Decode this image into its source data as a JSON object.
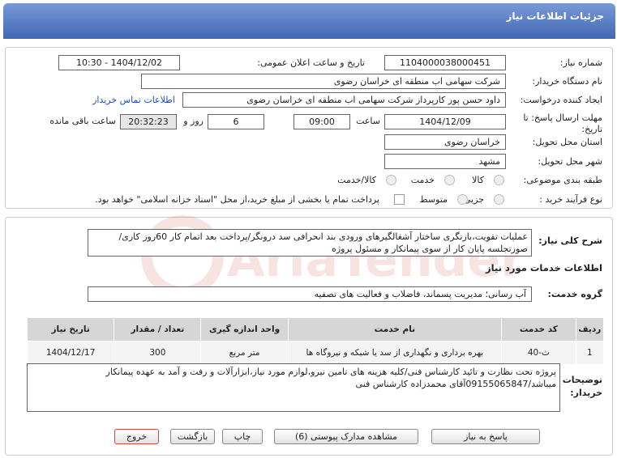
{
  "header": {
    "title": "جزئیات اطلاعات نیاز"
  },
  "labels": {
    "need_number": "شماره نیاز:",
    "announce_datetime": "تاریخ و ساعت اعلان عمومی:",
    "buyer_org": "نام دستگاه خریدار:",
    "creator": "ایجاد کننده درخواست:",
    "deadline": "مهلت ارسال پاسخ: تا تاریخ:",
    "time_word": "ساعت",
    "day_word": "روز و",
    "remaining_word": "ساعت باقی مانده",
    "province": "استان محل تحویل:",
    "city": "شهر محل تحویل:",
    "category": "طبقه بندی موضوعی:",
    "process": "نوع فرآیند خرید :",
    "description": "شرح کلی نیاز:",
    "services_info": "اطلاعات خدمات مورد نیاز",
    "service_group": "گروه خدمت:",
    "buyer_notes": "توضیحات خریدار:"
  },
  "values": {
    "need_number": "1104000038000451",
    "announce_datetime": "1404/12/02 - 10:30",
    "buyer_org": "شرکت سهامی اب منطقه ای خراسان رضوی",
    "creator": "داود حسن پور کارپرداز شرکت سهامی اب منطقه ای خراسان رضوی",
    "contact_link": "اطلاعات تماس خریدار",
    "deadline_date": "1404/12/09",
    "deadline_time": "09:00",
    "days": "6",
    "remaining_time": "20:32:23",
    "province": "خراسان رضوی",
    "city": "مشهد",
    "description": "عملیات تقویت،بازنگری ساختار آشغالگیرهای ورودی بند انحرافی سد درونگر/پرداخت بعد اتمام کار 60روز کاری/ صورتجلسه پایان کار از سوی پیمانکار و مسئول پروژه",
    "service_group": "آب رسانی؛ مدیریت پسماند، فاضلاب و فعالیت های تصفیه",
    "buyer_notes": "پروژه تحت نظارت و تائید کارشناس فنی/کلیه هزینه های تامین نیرو،لوازم مورد نیاز،ابزارآلات و رفت و آمد به عهده پیمانکار میباشد/09155065847آقای محمدزاده کارشناس فنی"
  },
  "category_options": [
    "کالا",
    "خدمت",
    "کالا/خدمت"
  ],
  "process_options": [
    "جزیی",
    "متوسط"
  ],
  "process_note": "پرداخت تمام یا بخشی از مبلغ خرید،از محل \"اسناد خزانه اسلامی\" خواهد بود.",
  "table": {
    "headers": [
      "ردیف",
      "کد خدمت",
      "نام خدمت",
      "واحد اندازه گیری",
      "تعداد / مقدار",
      "تاریخ نیاز"
    ],
    "rows": [
      [
        "1",
        "ث-40",
        "بهره برداری و نگهداری از سد یا شبکه و نیروگاه ها",
        "متر مربع",
        "300",
        "1404/12/17"
      ]
    ]
  },
  "buttons": {
    "reply": "پاسخ به نیاز",
    "docs": "مشاهده مدارک پیوستی (6)",
    "print": "چاپ",
    "back": "بازگشت",
    "exit": "خروج"
  },
  "watermark_text": "AriaTender.net",
  "colors": {
    "header_top": "#7a9ad6",
    "header_bottom": "#3f67b4",
    "link": "#1a4fc4",
    "exit_border": "#d04848"
  }
}
